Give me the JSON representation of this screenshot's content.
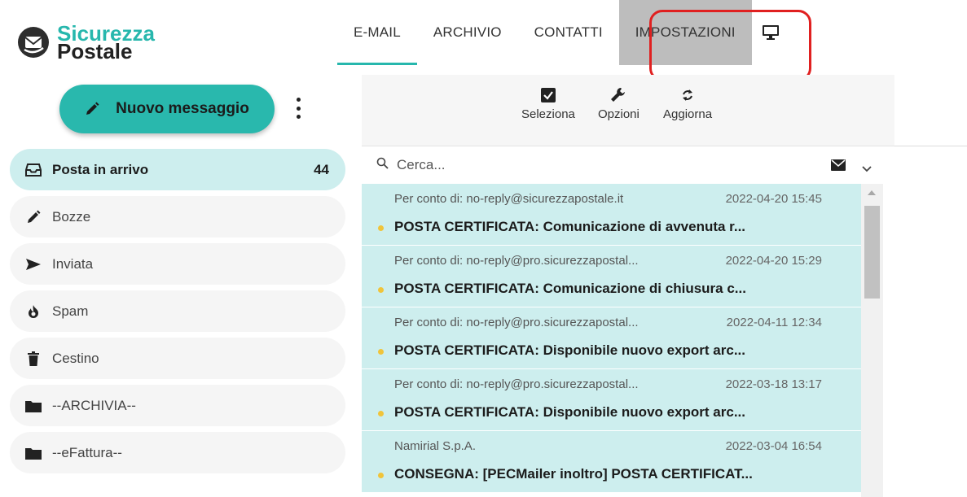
{
  "brand": {
    "line1": "Sicurezza",
    "line2": "Postale"
  },
  "nav": {
    "items": [
      {
        "label": "E-MAIL",
        "state": "active"
      },
      {
        "label": "ARCHIVIO",
        "state": ""
      },
      {
        "label": "CONTATTI",
        "state": ""
      },
      {
        "label": "IMPOSTAZIONI",
        "state": "selected"
      }
    ],
    "monitor_icon": "monitor-icon"
  },
  "compose": {
    "label": "Nuovo messaggio",
    "icon": "pencil-icon"
  },
  "folders": [
    {
      "label": "Posta in arrivo",
      "count": "44",
      "icon": "inbox-icon",
      "active": true
    },
    {
      "label": "Bozze",
      "count": "",
      "icon": "pencil-icon",
      "active": false
    },
    {
      "label": "Inviata",
      "count": "",
      "icon": "send-icon",
      "active": false
    },
    {
      "label": "Spam",
      "count": "",
      "icon": "fire-icon",
      "active": false
    },
    {
      "label": "Cestino",
      "count": "",
      "icon": "trash-icon",
      "active": false
    },
    {
      "label": "--ARCHIVIA--",
      "count": "",
      "icon": "folder-icon",
      "active": false
    },
    {
      "label": "--eFattura--",
      "count": "",
      "icon": "folder-icon",
      "active": false
    }
  ],
  "toolbar": {
    "select_label": "Seleziona",
    "options_label": "Opzioni",
    "refresh_label": "Aggiorna"
  },
  "search": {
    "placeholder": "Cerca..."
  },
  "messages": [
    {
      "from": "Per conto di: no-reply@sicurezzapostale.it",
      "date": "2022-04-20 15:45",
      "subject": "POSTA CERTIFICATA: Comunicazione di avvenuta r..."
    },
    {
      "from": "Per conto di: no-reply@pro.sicurezzapostal...",
      "date": "2022-04-20 15:29",
      "subject": "POSTA CERTIFICATA: Comunicazione di chiusura c..."
    },
    {
      "from": "Per conto di: no-reply@pro.sicurezzapostal...",
      "date": "2022-04-11 12:34",
      "subject": "POSTA CERTIFICATA: Disponibile nuovo export arc..."
    },
    {
      "from": "Per conto di: no-reply@pro.sicurezzapostal...",
      "date": "2022-03-18 13:17",
      "subject": "POSTA CERTIFICATA: Disponibile nuovo export arc..."
    },
    {
      "from": "Namirial S.p.A.",
      "date": "2022-03-04 16:54",
      "subject": "CONSEGNA: [PECMailer inoltro] POSTA CERTIFICAT..."
    }
  ],
  "colors": {
    "accent": "#29b8ad",
    "selected_row": "#cdeeee",
    "highlight": "#e02020"
  }
}
